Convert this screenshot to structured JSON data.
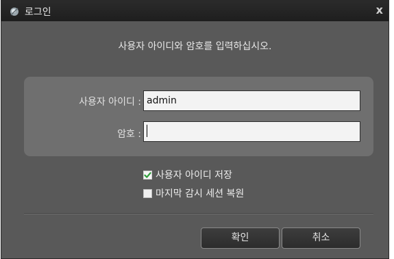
{
  "window": {
    "title": "로그인",
    "close_glyph": "x"
  },
  "instruction": "사용자 아이디와 암호를 입력하십시오.",
  "form": {
    "user_id_label": "사용자 아이디 :",
    "user_id_value": "admin",
    "password_label": "암호 :",
    "password_value": ""
  },
  "options": {
    "save_id_label": "사용자 아이디 저장",
    "save_id_checked": true,
    "restore_monitor_label": "마지막 감시 세션 복원",
    "restore_monitor_checked": false
  },
  "buttons": {
    "ok": "확인",
    "cancel": "취소"
  },
  "icons": {
    "app": "app-icon",
    "close": "close-icon",
    "check": "check-icon"
  },
  "colors": {
    "dialog_bg": "#595959",
    "panel_bg": "#6f6f6f",
    "check_green": "#2e9e3a"
  }
}
